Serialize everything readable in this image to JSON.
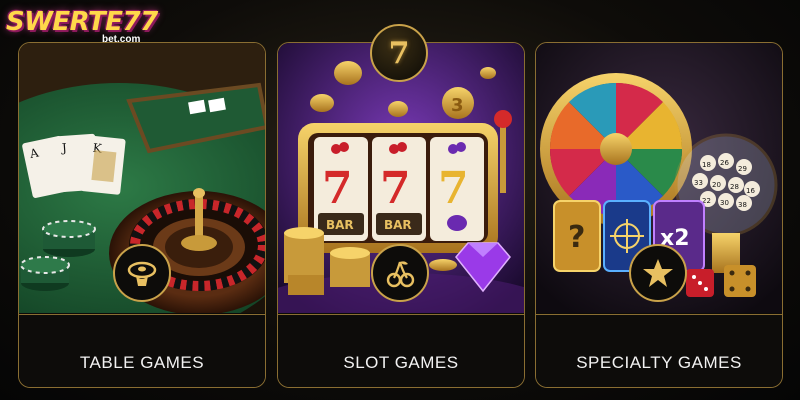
{
  "brand": {
    "name": "SWERTE77",
    "domain": "bet.com"
  },
  "badge": {
    "text": "7"
  },
  "cards": [
    {
      "id": "table",
      "label": "TABLE GAMES",
      "icon": "roulette-chip-icon"
    },
    {
      "id": "slot",
      "label": "SLOT GAMES",
      "icon": "cherry-icon"
    },
    {
      "id": "special",
      "label": "SPECIALTY GAMES",
      "icon": "star-icon"
    }
  ],
  "art": {
    "slot_reels": [
      "7",
      "7",
      "7"
    ],
    "slot_bars": [
      "BAR",
      "BAR"
    ],
    "coin_digits": [
      "7",
      "3"
    ],
    "lottery_balls": [
      "18",
      "26",
      "29",
      "33",
      "20",
      "28",
      "16",
      "22",
      "30",
      "38"
    ],
    "specialty_cards": [
      "?",
      "x2"
    ]
  },
  "colors": {
    "gold": "#c9a24a",
    "label": "#f2f2f2",
    "felt": "#1f5a34",
    "brand_pink": "#a4206a"
  }
}
